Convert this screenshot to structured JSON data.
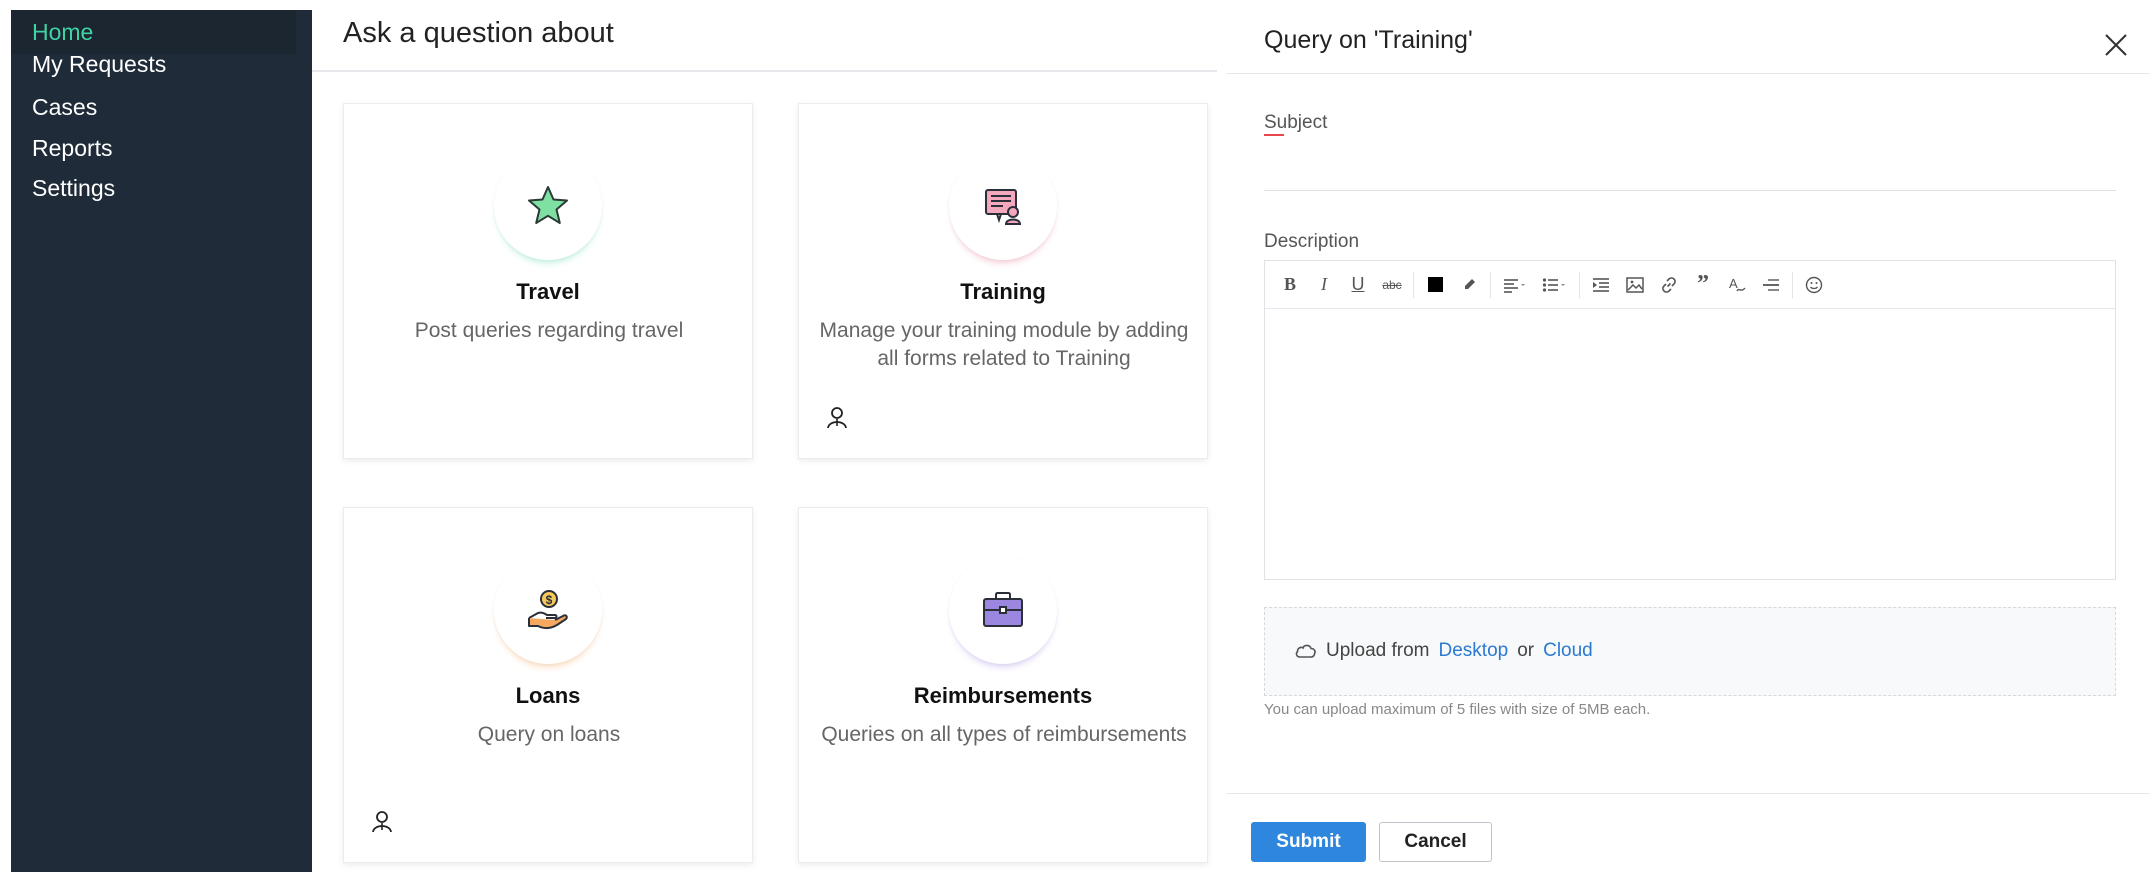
{
  "sidebar": {
    "items": [
      {
        "label": "Home",
        "active": true
      },
      {
        "label": "My Requests"
      },
      {
        "label": "Cases"
      },
      {
        "label": "Reports"
      },
      {
        "label": "Settings"
      }
    ]
  },
  "main": {
    "title": "Ask a question about",
    "cards": [
      {
        "title": "Travel",
        "description": "Post queries regarding travel",
        "icon": "star-icon"
      },
      {
        "title": "Training",
        "description": "Manage your training module by adding all forms related to Training",
        "icon": "certificate-icon"
      },
      {
        "title": "Loans",
        "description": "Query on loans",
        "icon": "hand-coin-icon"
      },
      {
        "title": "Reimbursements",
        "description": "Queries on all types of reimbursements",
        "icon": "briefcase-icon"
      }
    ]
  },
  "panel": {
    "title": "Query on 'Training'",
    "subject_label": "Subject",
    "description_label": "Description",
    "upload": {
      "prefix": "Upload from",
      "desktop": "Desktop",
      "or": "or",
      "cloud": "Cloud",
      "note": "You can upload maximum of 5 files with size of 5MB each."
    },
    "buttons": {
      "submit": "Submit",
      "cancel": "Cancel"
    }
  },
  "colors": {
    "sidebar_bg": "#1f2b38",
    "active_text": "#3fd3a4",
    "primary": "#2e86dd",
    "link": "#2b7ad1"
  }
}
